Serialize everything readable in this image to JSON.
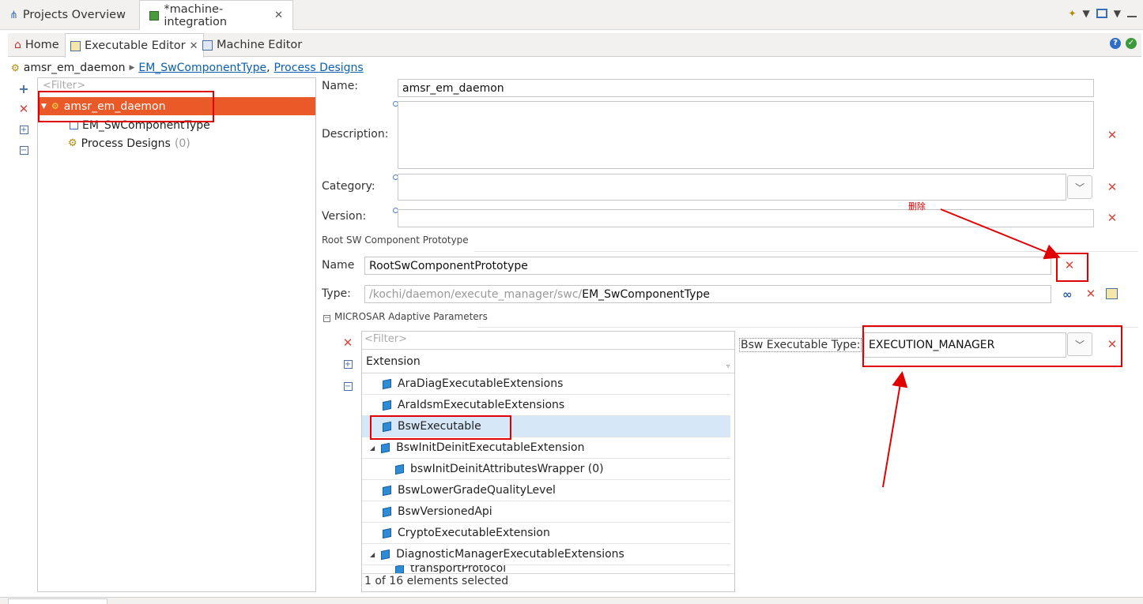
{
  "project_tabs": {
    "overview": "Projects Overview",
    "integration": "*machine-integration"
  },
  "editor_tabs": {
    "home": "Home",
    "executable": "Executable Editor",
    "machine": "Machine Editor"
  },
  "breadcrumb": {
    "root": "amsr_em_daemon",
    "link1": "EM_SwComponentType",
    "sep": ",",
    "link2": "Process Designs"
  },
  "tree": {
    "filter_placeholder": "<Filter>",
    "items": [
      {
        "label": "amsr_em_daemon"
      },
      {
        "label": "EM_SwComponentType"
      },
      {
        "label": "Process Designs",
        "count": "(0)"
      }
    ]
  },
  "form": {
    "name_label": "Name:",
    "name_value": "amsr_em_daemon",
    "description_label": "Description:",
    "category_label": "Category:",
    "version_label": "Version:",
    "root_section": "Root SW Component Prototype",
    "proto_name_label": "Name",
    "proto_name_value": "RootSwComponentPrototype",
    "type_label": "Type:",
    "type_path_prefix": "/kochi/daemon/execute_manager/swc/",
    "type_path_suffix": "EM_SwComponentType",
    "annotation": "删除",
    "microsar_section": "MICROSAR Adaptive Parameters",
    "bsw_type_label": "Bsw Executable Type:",
    "bsw_type_value": "EXECUTION_MANAGER"
  },
  "extensions": {
    "filter_placeholder": "<Filter>",
    "header": "Extension",
    "rows": [
      {
        "label": "AraDiagExecutableExtensions"
      },
      {
        "label": "AraIdsmExecutableExtensions"
      },
      {
        "label": "BswExecutable"
      },
      {
        "label": "BswInitDeinitExecutableExtension"
      },
      {
        "label": "bswInitDeinitAttributesWrapper (0)"
      },
      {
        "label": "BswLowerGradeQualityLevel"
      },
      {
        "label": "BswVersionedApi"
      },
      {
        "label": "CryptoExecutableExtension"
      },
      {
        "label": "DiagnosticManagerExecutableExtensions"
      },
      {
        "label": "transportProtocol"
      }
    ],
    "status": "1 of 16 elements selected"
  },
  "colors": {
    "selection": "#ea5a28",
    "highlight_row": "#d6e8f8",
    "annotation_red": "#e00000",
    "link": "#0b5fb0"
  }
}
